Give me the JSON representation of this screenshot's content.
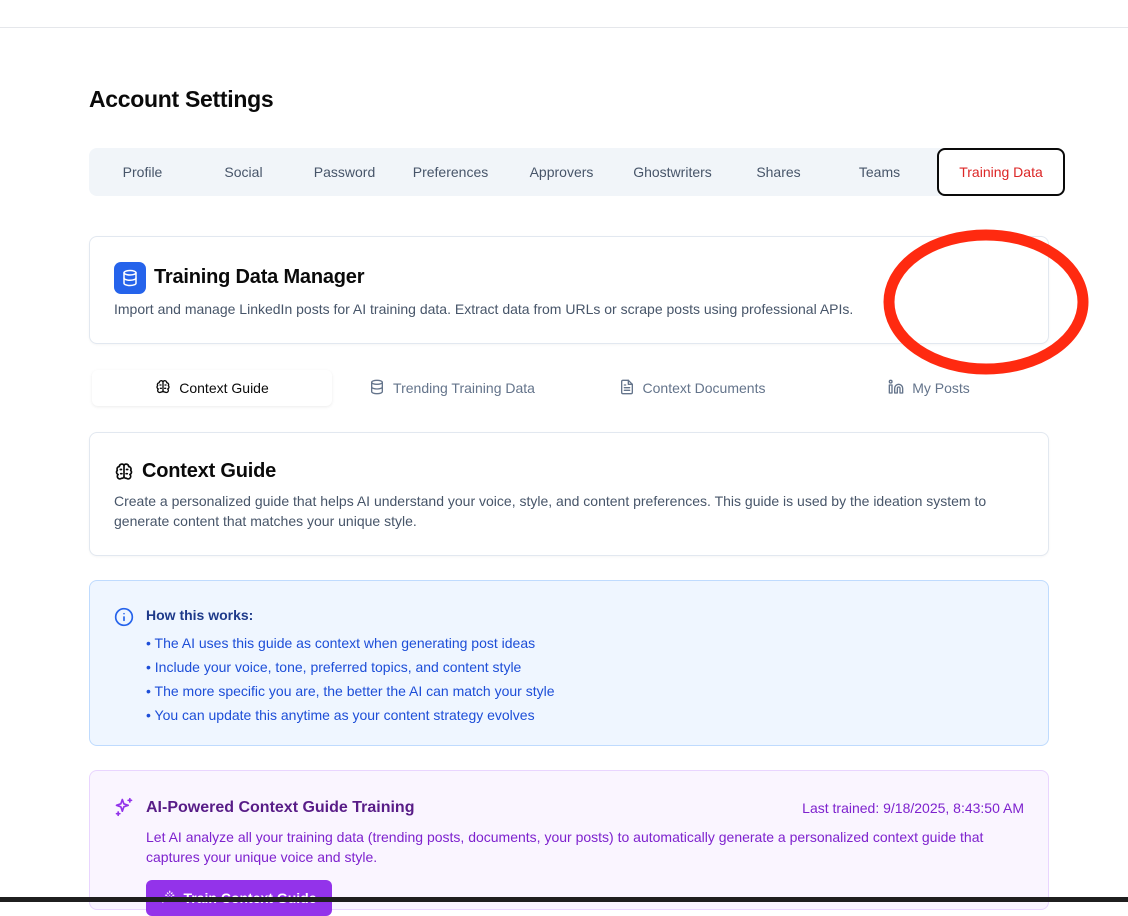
{
  "page": {
    "title": "Account Settings"
  },
  "settings_tabs": [
    {
      "label": "Profile",
      "active": false
    },
    {
      "label": "Social",
      "active": false
    },
    {
      "label": "Password",
      "active": false
    },
    {
      "label": "Preferences",
      "active": false
    },
    {
      "label": "Approvers",
      "active": false
    },
    {
      "label": "Ghostwriters",
      "active": false
    },
    {
      "label": "Shares",
      "active": false
    },
    {
      "label": "Teams",
      "active": false
    },
    {
      "label": "Training Data",
      "active": true
    }
  ],
  "manager": {
    "icon": "database-icon",
    "title": "Training Data Manager",
    "description": "Import and manage LinkedIn posts for AI training data. Extract data from URLs or scrape posts using professional APIs."
  },
  "sub_tabs": [
    {
      "label": "Context Guide",
      "icon": "brain-icon",
      "active": true
    },
    {
      "label": "Trending Training Data",
      "icon": "database-icon",
      "active": false
    },
    {
      "label": "Context Documents",
      "icon": "document-icon",
      "active": false
    },
    {
      "label": "My Posts",
      "icon": "linkedin-icon",
      "active": false
    }
  ],
  "context_guide": {
    "title": "Context Guide",
    "description": "Create a personalized guide that helps AI understand your voice, style, and content preferences. This guide is used by the ideation system to generate content that matches your unique style."
  },
  "info": {
    "heading": "How this works:",
    "items": [
      "• The AI uses this guide as context when generating post ideas",
      "• Include your voice, tone, preferred topics, and content style",
      "• The more specific you are, the better the AI can match your style",
      "• You can update this anytime as your content strategy evolves"
    ]
  },
  "ai_training": {
    "title": "AI-Powered Context Guide Training",
    "last_trained": "Last trained: 9/18/2025, 8:43:50 AM",
    "description": "Let AI analyze all your training data (trending posts, documents, your posts) to automatically generate a personalized context guide that captures your unique voice and style.",
    "button_label": "Train Context Guide"
  },
  "colors": {
    "active_tab_text": "#dc2626",
    "manager_icon_bg": "#2563eb",
    "info_bg": "#eff6ff",
    "info_text": "#1d4ed8",
    "ai_bg": "#faf5ff",
    "ai_text": "#7e22ce",
    "ai_button": "#9333ea",
    "annotation": "#ff2a10"
  }
}
